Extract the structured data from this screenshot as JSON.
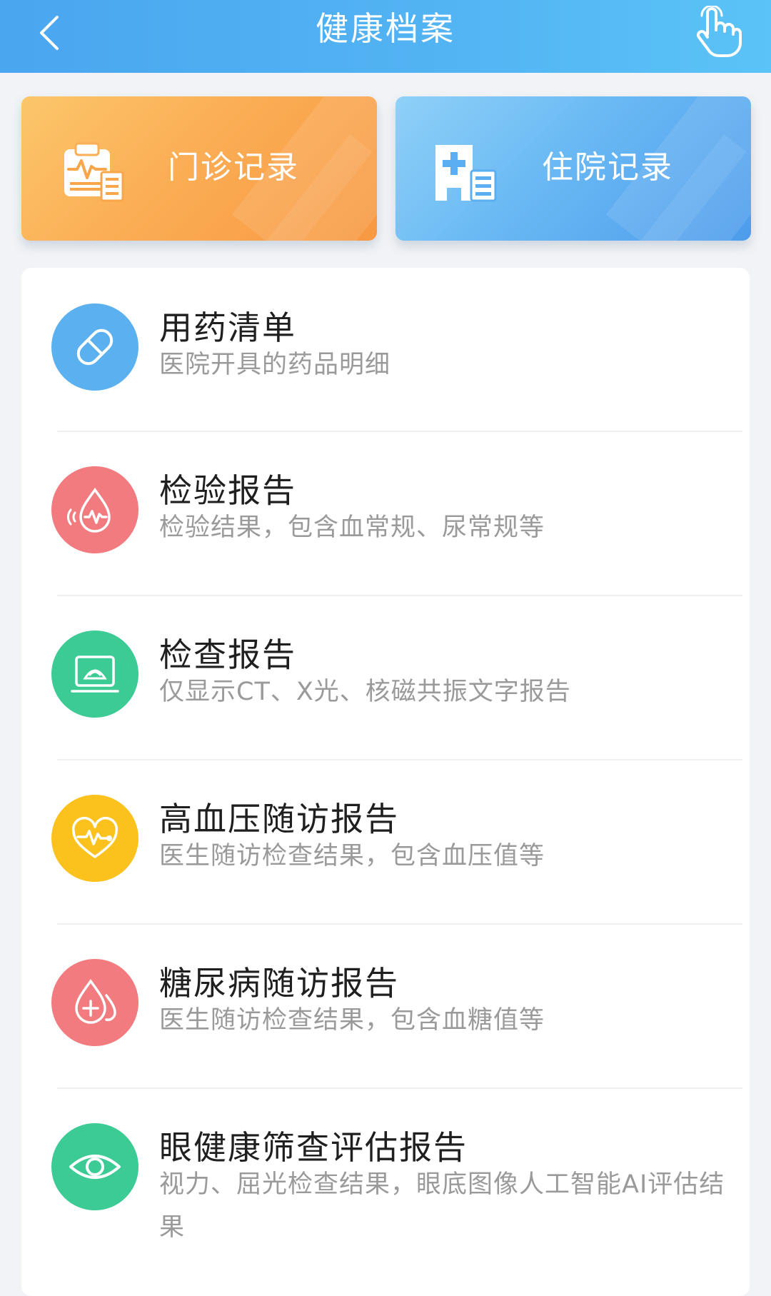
{
  "header": {
    "title": "健康档案",
    "back_icon": "chevron-left-icon",
    "action_icon": "hand-pointer-icon"
  },
  "cards": [
    {
      "label": "门诊记录",
      "icon": "clipboard-ecg-icon",
      "color": "#f9a54a"
    },
    {
      "label": "住院记录",
      "icon": "hospital-building-icon",
      "color": "#5aaef1"
    }
  ],
  "items": [
    {
      "title": "用药清单",
      "desc": "医院开具的药品明细",
      "icon": "pill-icon",
      "color": "#5bb0f0"
    },
    {
      "title": "检验报告",
      "desc": "检验结果，包含血常规、尿常规等",
      "icon": "blood-drop-wave-icon",
      "color": "#f27b7f"
    },
    {
      "title": "检查报告",
      "desc": "仅显示CT、X光、核磁共振文字报告",
      "icon": "ultrasound-screen-icon",
      "color": "#3ccb94"
    },
    {
      "title": "高血压随访报告",
      "desc": "医生随访检查结果，包含血压值等",
      "icon": "heart-pulse-icon",
      "color": "#fbc21d"
    },
    {
      "title": "糖尿病随访报告",
      "desc": "医生随访检查结果，包含血糖值等",
      "icon": "drop-plus-icon",
      "color": "#f27b7f"
    },
    {
      "title": "眼健康筛查评估报告",
      "desc": "视力、屈光检查结果，眼底图像人工智能AI评估结果",
      "icon": "eye-icon",
      "color": "#3ccb94"
    }
  ]
}
